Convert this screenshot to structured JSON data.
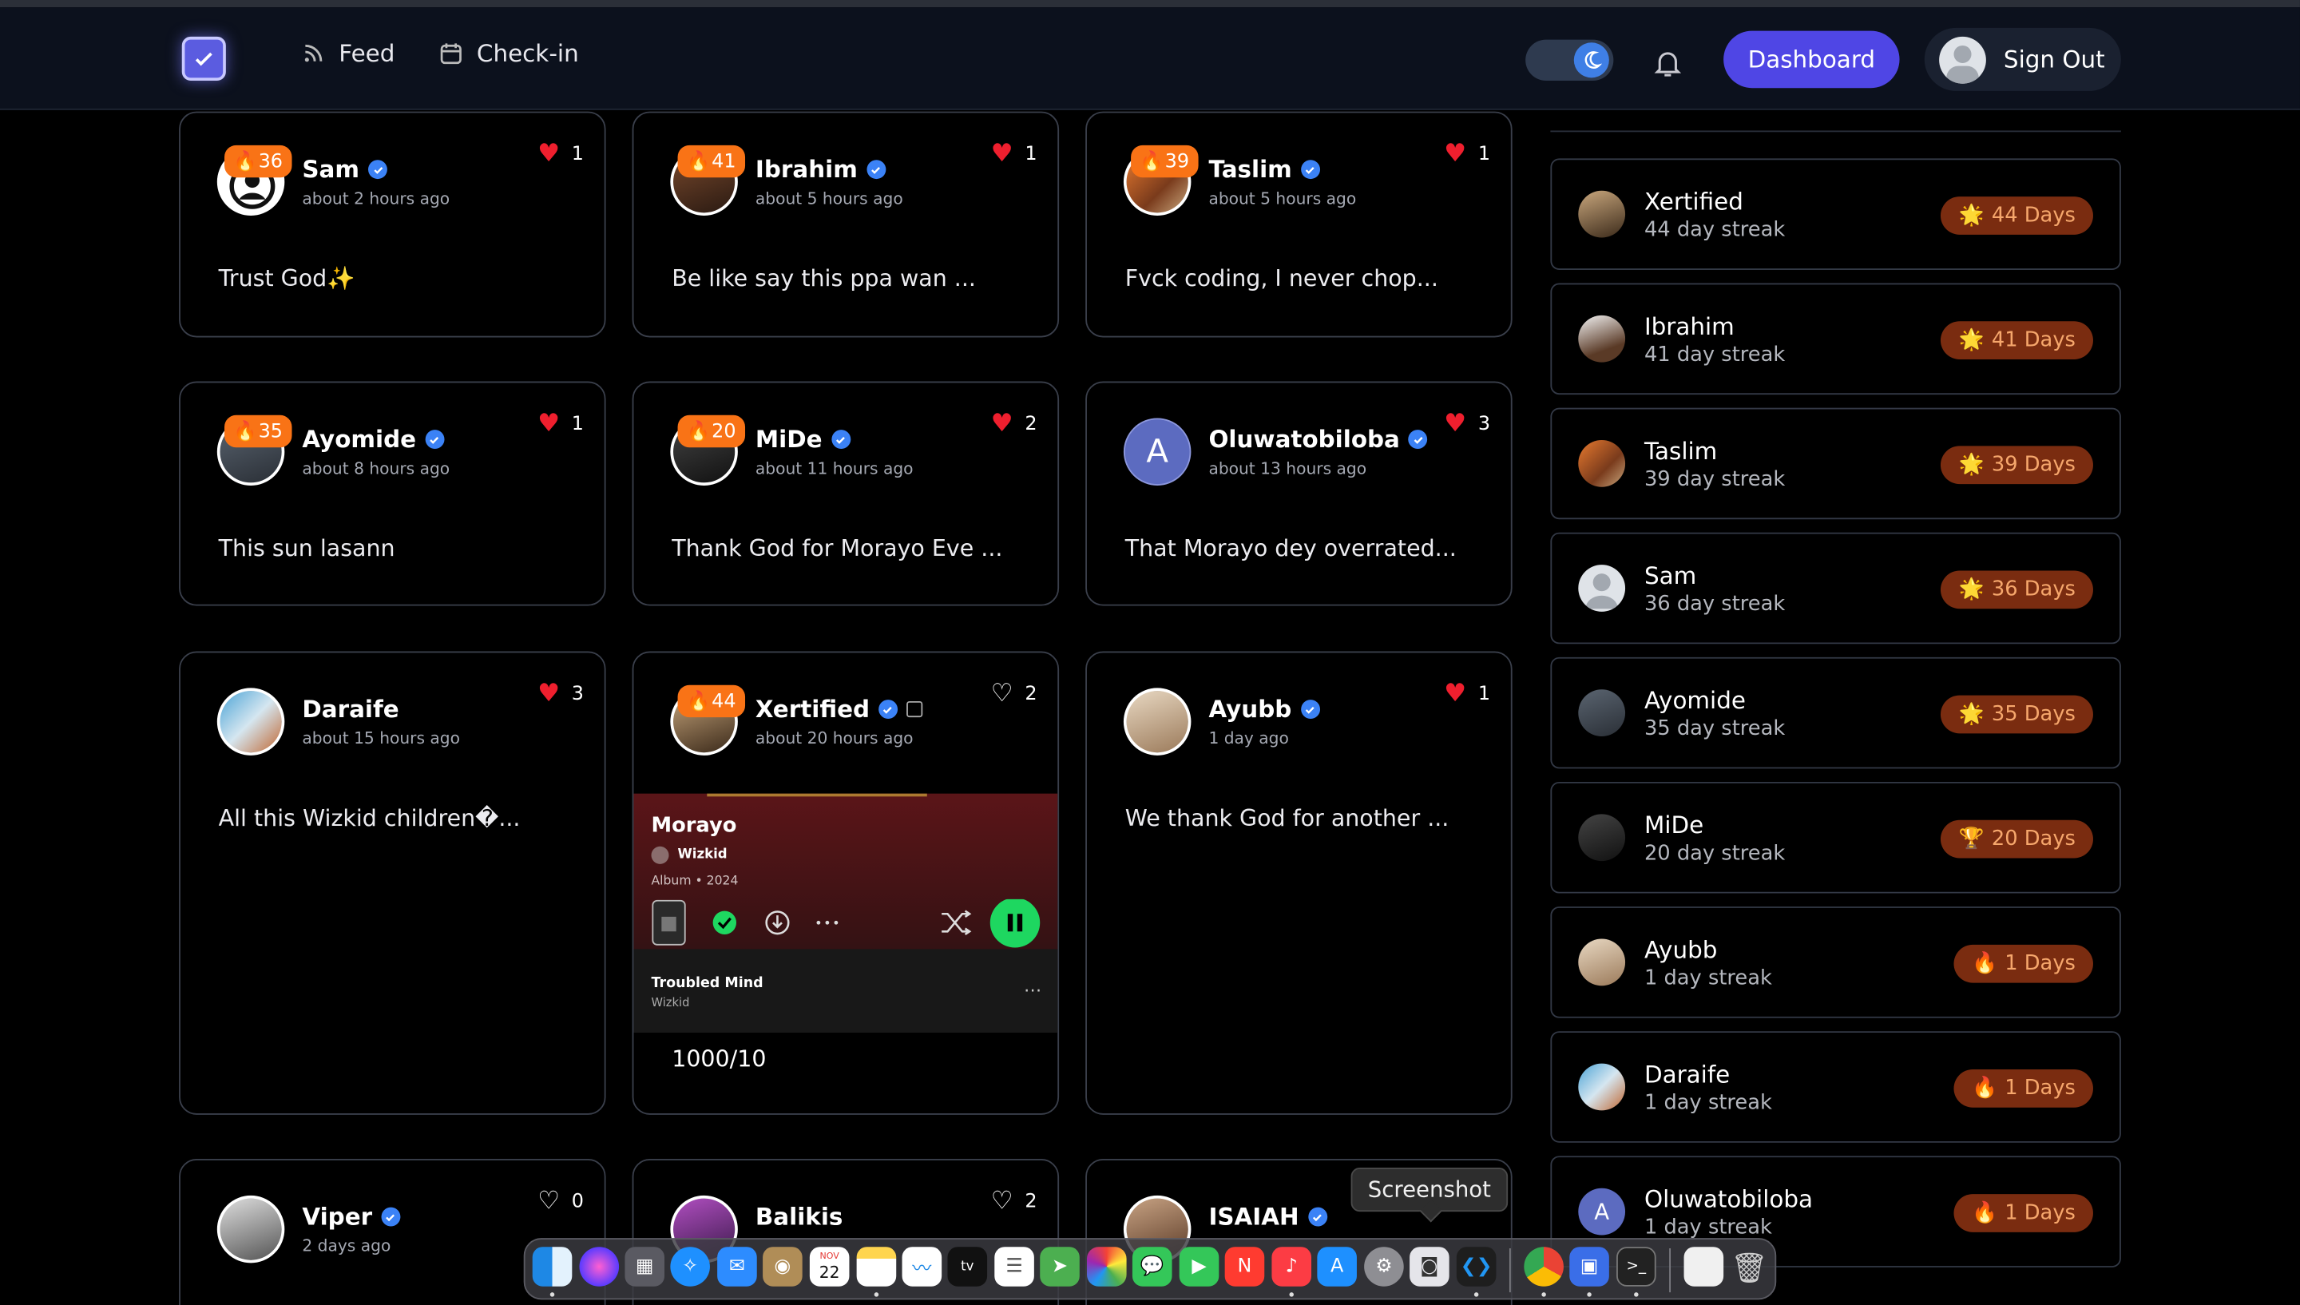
{
  "nav": {
    "links": [
      {
        "label": "Feed",
        "icon": "rss-icon"
      },
      {
        "label": "Check-in",
        "icon": "calendar-icon"
      }
    ],
    "dashboard_label": "Dashboard",
    "signout_label": "Sign Out",
    "accent": "#4f46e5"
  },
  "posts": [
    {
      "name": "Sam",
      "streak": "36",
      "time": "about 2 hours ago",
      "likes": "1",
      "liked": true,
      "text": "Trust God✨"
    },
    {
      "name": "Ibrahim",
      "streak": "41",
      "time": "about 5 hours ago",
      "likes": "1",
      "liked": true,
      "text": "Be like say this ppa wan ..."
    },
    {
      "name": "Taslim",
      "streak": "39",
      "time": "about 5 hours ago",
      "likes": "1",
      "liked": true,
      "text": "Fvck coding, I never chop..."
    },
    {
      "name": "Ayomide",
      "streak": "35",
      "time": "about 8 hours ago",
      "likes": "1",
      "liked": true,
      "text": "This sun lasann"
    },
    {
      "name": "MiDe",
      "streak": "20",
      "time": "about 11 hours ago",
      "likes": "2",
      "liked": true,
      "text": "Thank God for Morayo Eve ..."
    },
    {
      "name": "Oluwatobiloba",
      "avatar_letter": "A",
      "time": "about 13 hours ago",
      "likes": "3",
      "liked": true,
      "text": "That Morayo dey overrated..."
    },
    {
      "name": "Daraife",
      "time": "about 15 hours ago",
      "likes": "3",
      "liked": true,
      "text": "All this Wizkid children�..."
    },
    {
      "name": "Xertified",
      "streak": "44",
      "time": "about 20 hours ago",
      "likes": "2",
      "liked": false,
      "text": "1000/10",
      "music": {
        "title": "Morayo",
        "artist": "Wizkid",
        "meta": "Album • 2024",
        "track": "Troubled Mind",
        "track_artist": "Wizkid"
      }
    },
    {
      "name": "Ayubb",
      "time": "1 day ago",
      "likes": "1",
      "liked": true,
      "text": "We thank God for another ..."
    },
    {
      "name": "Viper",
      "time": "2 days ago",
      "likes": "0",
      "liked": false
    },
    {
      "name": "Balikis",
      "likes": "2",
      "liked": false
    },
    {
      "name": "ISAIAH"
    }
  ],
  "leaderboard": [
    {
      "name": "Xertified",
      "streak": "44 day streak",
      "badge": "44 Days",
      "icon": "🌟"
    },
    {
      "name": "Ibrahim",
      "streak": "41 day streak",
      "badge": "41 Days",
      "icon": "🌟"
    },
    {
      "name": "Taslim",
      "streak": "39 day streak",
      "badge": "39 Days",
      "icon": "🌟"
    },
    {
      "name": "Sam",
      "streak": "36 day streak",
      "badge": "36 Days",
      "icon": "🌟"
    },
    {
      "name": "Ayomide",
      "streak": "35 day streak",
      "badge": "35 Days",
      "icon": "🌟"
    },
    {
      "name": "MiDe",
      "streak": "20 day streak",
      "badge": "20 Days",
      "icon": "🏆"
    },
    {
      "name": "Ayubb",
      "streak": "1 day streak",
      "badge": "1 Days",
      "icon": "🔥"
    },
    {
      "name": "Daraife",
      "streak": "1 day streak",
      "badge": "1 Days",
      "icon": "🔥"
    },
    {
      "name": "Oluwatobiloba",
      "avatar_letter": "A",
      "streak": "1 day streak",
      "badge": "1 Days",
      "icon": "🔥"
    }
  ],
  "tooltip": "Screenshot",
  "dock": {
    "calendar_month": "NOV",
    "calendar_day": "22"
  }
}
